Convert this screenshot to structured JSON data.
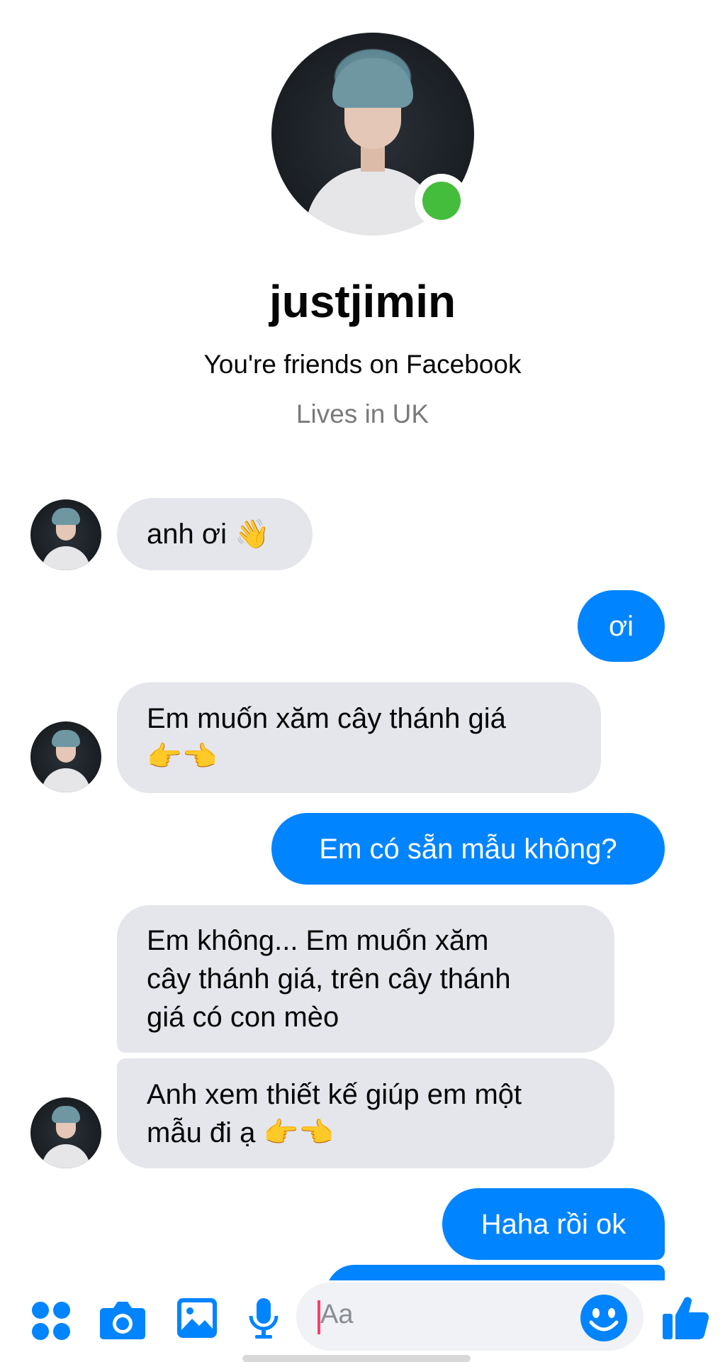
{
  "profile": {
    "name": "justjimin",
    "friends_text": "You're friends on Facebook",
    "location_text": "Lives in UK",
    "online": true
  },
  "messages": [
    {
      "from": "them",
      "text": "anh ơi 👋"
    },
    {
      "from": "me",
      "text": "ơi"
    },
    {
      "from": "them",
      "text": "Em muốn xăm cây thánh giá\n👉👈"
    },
    {
      "from": "me",
      "text": "Em có sẵn mẫu không?"
    },
    {
      "from": "them",
      "text": "Em không... Em muốn xăm\ncây thánh giá, trên cây thánh\ngiá có con mèo"
    },
    {
      "from": "them",
      "text": "Anh xem thiết kế giúp em một\nmẫu đi ạ 👉👈"
    },
    {
      "from": "me",
      "text": "Haha rồi ok"
    }
  ],
  "composer": {
    "placeholder": "Aa",
    "icons": [
      "menu-dots-icon",
      "camera-icon",
      "gallery-icon",
      "microphone-icon",
      "emoji-icon",
      "thumbs-up-icon"
    ]
  },
  "colors": {
    "accent": "#0084ff",
    "incoming_bubble": "#e4e6eb",
    "online": "#45bd3c"
  }
}
